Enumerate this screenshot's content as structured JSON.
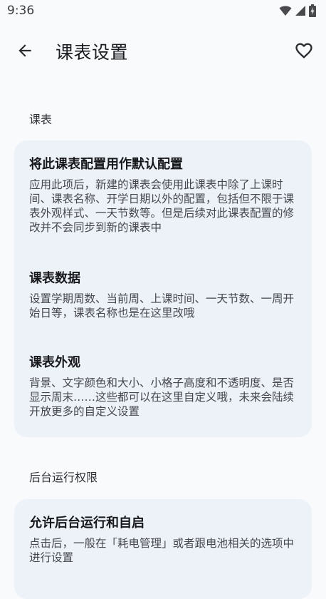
{
  "status_bar": {
    "time": "9:36",
    "icons": [
      "wifi-icon",
      "signal-icon",
      "battery-charging-icon"
    ]
  },
  "app_bar": {
    "back_icon": "arrow-back-icon",
    "title": "课表设置",
    "favorite_icon": "heart-outline-icon"
  },
  "sections": [
    {
      "label": "课表",
      "items": [
        {
          "title": "将此课表配置用作默认配置",
          "description": "应用此项后，新建的课表会使用此课表中除了上课时间、课表名称、开学日期以外的配置，包括但不限于课表外观样式、一天节数等。但是后续对此课表配置的修改并不会同步到新的课表中"
        },
        {
          "title": "课表数据",
          "description": "设置学期周数、当前周、上课时间、一天节数、一周开始日等，课表名称也是在这里改哦"
        },
        {
          "title": "课表外观",
          "description": "背景、文字颜色和大小、小格子高度和不透明度、是否显示周末……这些都可以在这里自定义哦，未来会陆续开放更多的自定义设置"
        }
      ]
    },
    {
      "label": "后台运行权限",
      "items": [
        {
          "title": "允许后台运行和自启",
          "description": "点击后，一般在「耗电管理」或者跟电池相关的选项中进行设置"
        }
      ]
    }
  ]
}
